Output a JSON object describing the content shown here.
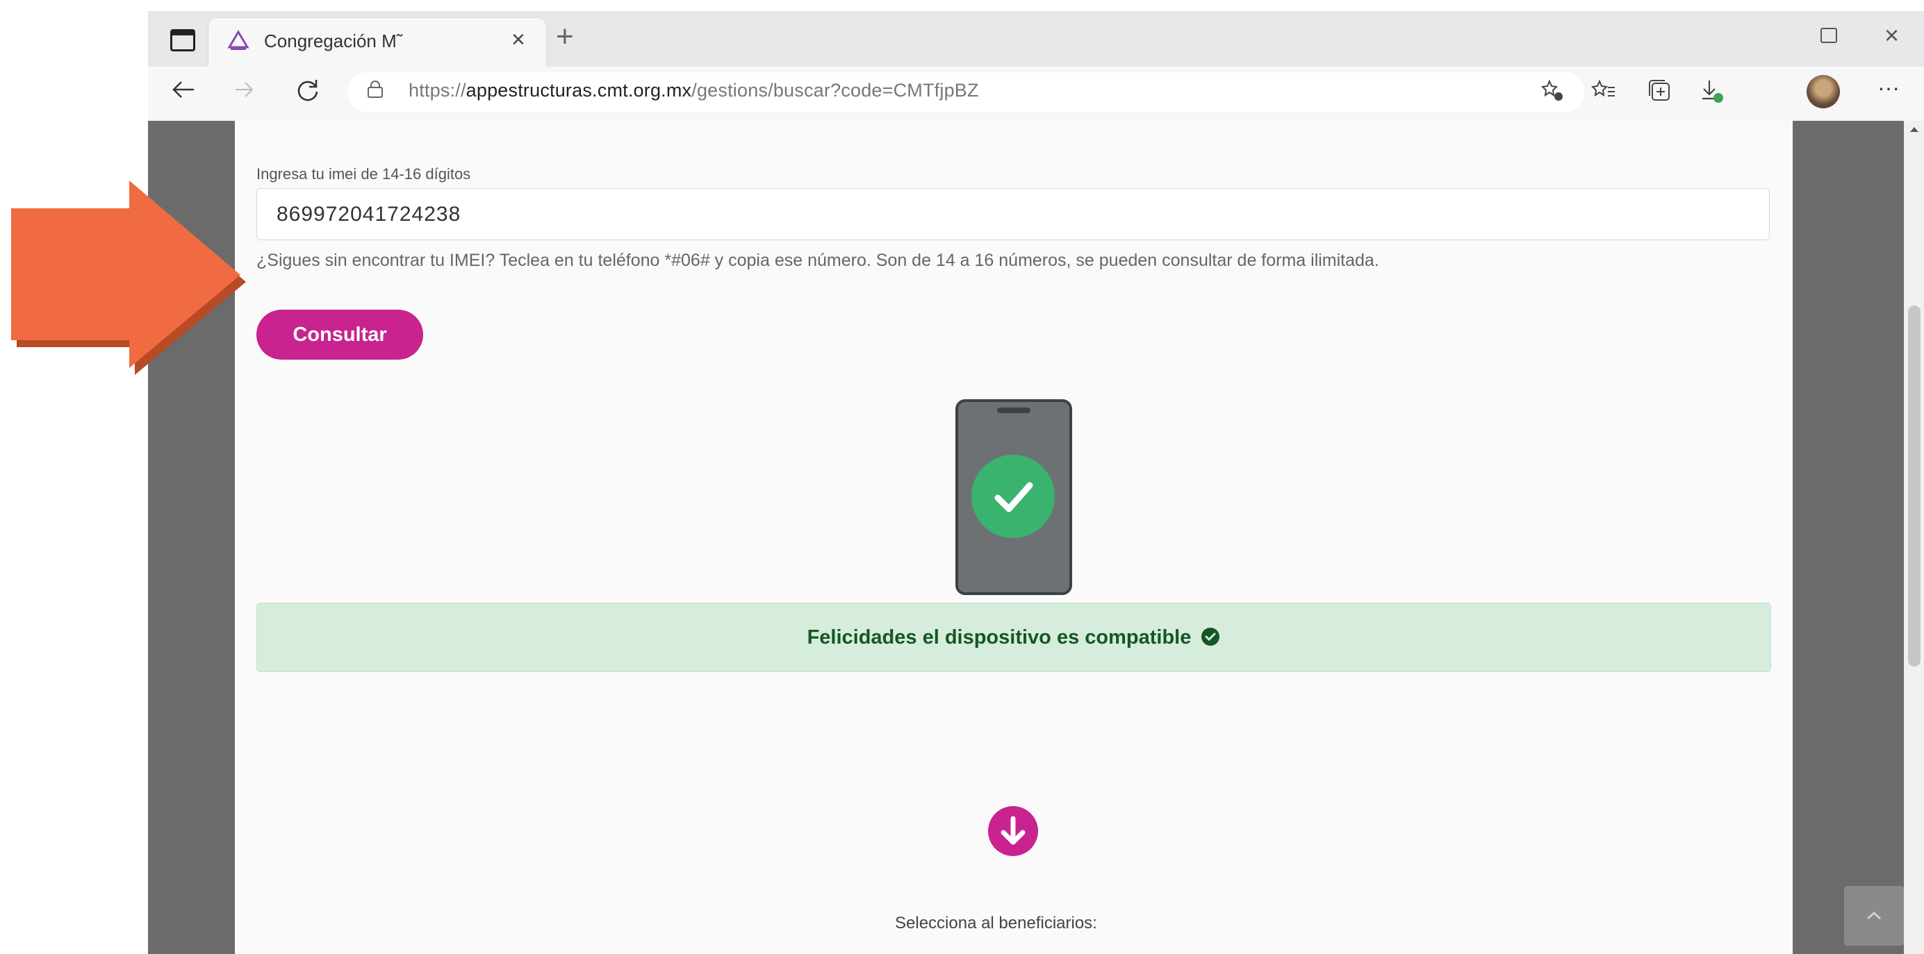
{
  "browser": {
    "tab_title": "Congregación M˜",
    "url_prefix": "https://",
    "url_host": "appestructuras.cmt.org.mx",
    "url_path": "/gestions/buscar?code=CMTfjpBZ",
    "tab_close": "×",
    "new_tab": "+",
    "close_window": "×",
    "more_menu": "···"
  },
  "form": {
    "label": "Ingresa tu imei de 14-16 dígitos",
    "imei_value": "869972041724238",
    "help_text": "¿Sigues sin encontrar tu IMEI? Teclea en tu teléfono *#06# y copia ese número. Son de 14 a 16 números, se pueden consultar de forma ilimitada.",
    "submit_label": "Consultar"
  },
  "result": {
    "message": "Felicidades el dispositivo es compatible"
  },
  "beneficiaries": {
    "label": "Selecciona al beneficiarios:"
  },
  "colors": {
    "accent": "#c8238f",
    "success_bg": "#d6ecdd",
    "success_text": "#155724",
    "check_green": "#3ab36e",
    "overlay_arrow": "#f06a42"
  },
  "icons": [
    "sidebar-toggle-icon",
    "favicon-icon",
    "back-icon",
    "forward-icon",
    "refresh-icon",
    "lock-icon",
    "favorites-add-icon",
    "favorites-icon",
    "collections-icon",
    "download-icon",
    "more-icon",
    "check-icon",
    "arrow-down-icon",
    "chevron-up-icon"
  ]
}
